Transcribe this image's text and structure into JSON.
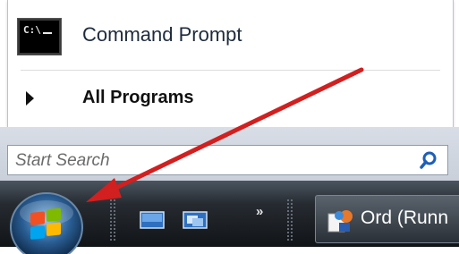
{
  "start_menu": {
    "items": [
      {
        "label": "Command Prompt",
        "icon": "command-prompt-icon",
        "icon_text": "C:\\"
      },
      {
        "label": "All Programs",
        "icon": "arrow-right-icon"
      }
    ]
  },
  "search": {
    "placeholder": "Start Search",
    "icon": "search-icon"
  },
  "taskbar": {
    "start_button_icon": "windows-logo-icon",
    "quick_launch": [
      {
        "icon": "show-desktop-icon"
      },
      {
        "icon": "switch-windows-icon"
      }
    ],
    "overflow_label": "»",
    "tasks": [
      {
        "label": "Ord (Runn",
        "icon": "word-app-icon"
      }
    ]
  },
  "annotation": {
    "color": "#d21f1f",
    "points_to": "start-button"
  }
}
